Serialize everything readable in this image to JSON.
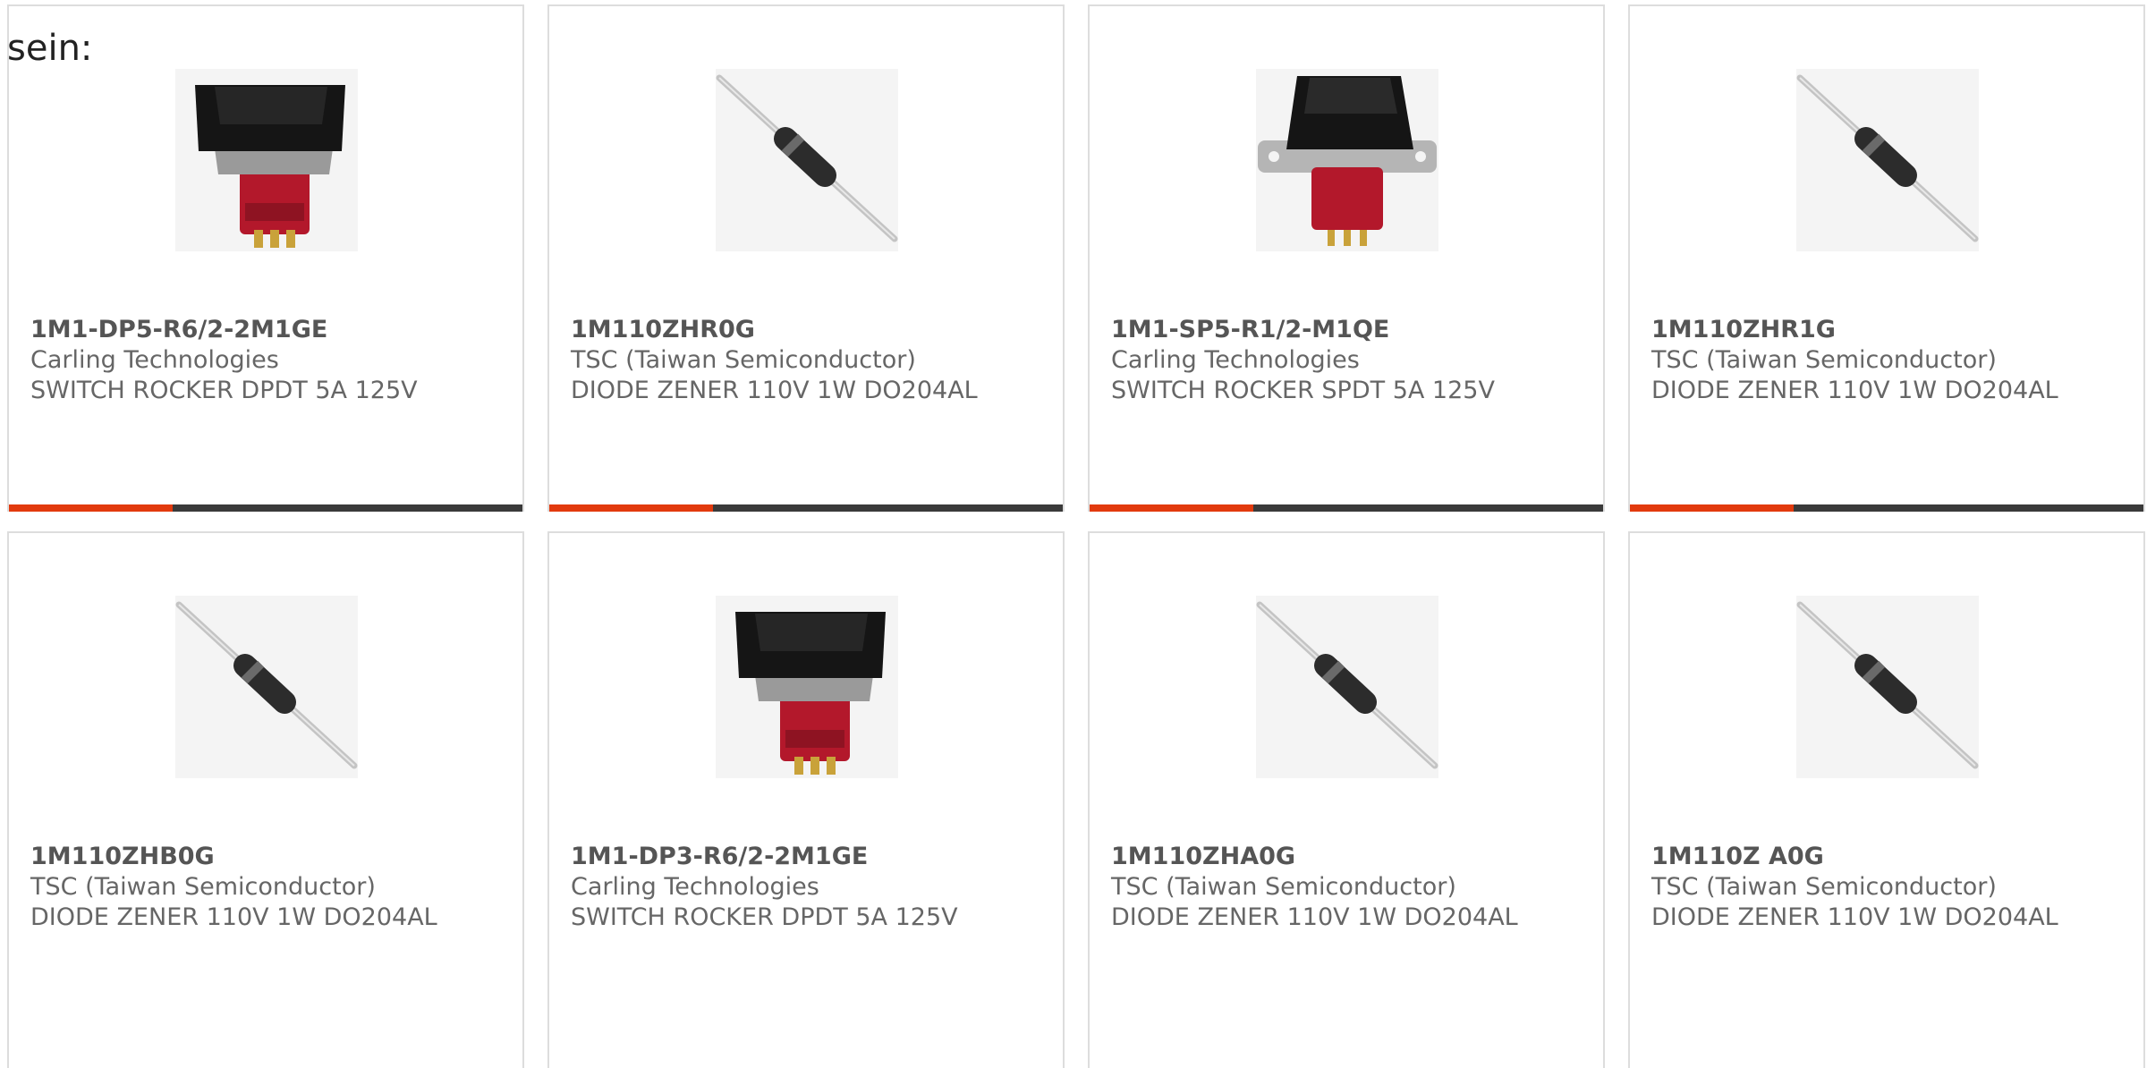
{
  "intro_text": "sein:",
  "colors": {
    "accent": "#e23a0e",
    "bar": "#3a3a3a",
    "border": "#dddddd"
  },
  "products": [
    {
      "part_number": "1M1-DP5-R6/2-2M1GE",
      "manufacturer": "Carling Technologies",
      "description": "SWITCH ROCKER DPDT 5A 125V",
      "image": "rocker-switch-dpdt"
    },
    {
      "part_number": "1M110ZHR0G",
      "manufacturer": "TSC (Taiwan Semiconductor)",
      "description": "DIODE ZENER 110V 1W DO204AL",
      "image": "zener-diode"
    },
    {
      "part_number": "1M1-SP5-R1/2-M1QE",
      "manufacturer": "Carling Technologies",
      "description": "SWITCH ROCKER SPDT 5A 125V",
      "image": "rocker-switch-spdt"
    },
    {
      "part_number": "1M110ZHR1G",
      "manufacturer": "TSC (Taiwan Semiconductor)",
      "description": "DIODE ZENER 110V 1W DO204AL",
      "image": "zener-diode"
    },
    {
      "part_number": "1M110ZHB0G",
      "manufacturer": "TSC (Taiwan Semiconductor)",
      "description": "DIODE ZENER 110V 1W DO204AL",
      "image": "zener-diode"
    },
    {
      "part_number": "1M1-DP3-R6/2-2M1GE",
      "manufacturer": "Carling Technologies",
      "description": "SWITCH ROCKER DPDT 5A 125V",
      "image": "rocker-switch-dpdt"
    },
    {
      "part_number": "1M110ZHA0G",
      "manufacturer": "TSC (Taiwan Semiconductor)",
      "description": "DIODE ZENER 110V 1W DO204AL",
      "image": "zener-diode"
    },
    {
      "part_number": "1M110Z A0G",
      "manufacturer": "TSC (Taiwan Semiconductor)",
      "description": "DIODE ZENER 110V 1W DO204AL",
      "image": "zener-diode"
    }
  ]
}
